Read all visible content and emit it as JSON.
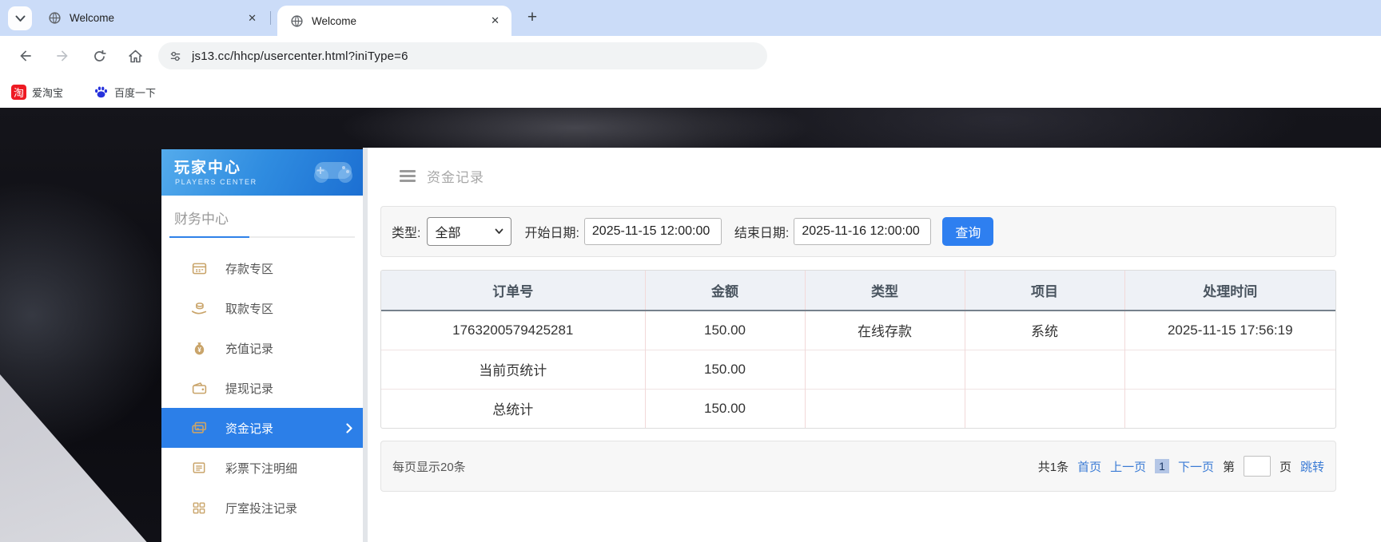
{
  "browser": {
    "tabs": [
      {
        "title": "Welcome",
        "icon": "globe-icon"
      },
      {
        "title": "Welcome",
        "icon": "globe-icon"
      }
    ],
    "url": "js13.cc/hhcp/usercenter.html?iniType=6",
    "bookmarks": [
      {
        "label": "爱淘宝",
        "icon": "taobao-icon",
        "icon_glyph": "淘"
      },
      {
        "label": "百度一下",
        "icon": "baidu-paw-icon"
      }
    ]
  },
  "sidebar": {
    "title": "玩家中心",
    "subtitle": "PLAYERS CENTER",
    "section": "财务中心",
    "items": [
      {
        "label": "存款专区",
        "icon": "deposit-machine-icon",
        "active": false
      },
      {
        "label": "取款专区",
        "icon": "withdraw-hand-icon",
        "active": false
      },
      {
        "label": "充值记录",
        "icon": "moneybag-icon",
        "active": false
      },
      {
        "label": "提现记录",
        "icon": "wallet-icon",
        "active": false
      },
      {
        "label": "资金记录",
        "icon": "cards-icon",
        "active": true
      },
      {
        "label": "彩票下注明细",
        "icon": "bet-list-icon",
        "active": false
      },
      {
        "label": "厅室投注记录",
        "icon": "grid-list-icon",
        "active": false
      }
    ]
  },
  "main": {
    "page_title": "资金记录",
    "filter": {
      "type_label": "类型:",
      "type_value": "全部",
      "start_label": "开始日期:",
      "start_value": "2025-11-15 12:00:00",
      "end_label": "结束日期:",
      "end_value": "2025-11-16 12:00:00",
      "search_label": "查询"
    },
    "table": {
      "headers": [
        "订单号",
        "金额",
        "类型",
        "项目",
        "处理时间"
      ],
      "rows": [
        [
          "1763200579425281",
          "150.00",
          "在线存款",
          "系统",
          "2025-11-15 17:56:19"
        ],
        [
          "当前页统计",
          "150.00",
          "",
          "",
          ""
        ],
        [
          "总统计",
          "150.00",
          "",
          "",
          ""
        ]
      ]
    },
    "pagination": {
      "per_page": "每页显示20条",
      "total": "共1条",
      "first": "首页",
      "prev": "上一页",
      "current": "1",
      "next": "下一页",
      "jump_pre": "第",
      "jump_post": "页",
      "jump": "跳转",
      "page_input_value": ""
    }
  },
  "colors": {
    "tabstrip_bg": "#cbdcf8",
    "accent_blue": "#2c7fe8",
    "button_blue": "#2e7ff0",
    "link_blue": "#3a7bd5",
    "gold_icon": "#c9a46a",
    "sidebar_gradient_start": "#54abec",
    "sidebar_gradient_end": "#1c6fd2",
    "table_header_bg": "#eef1f6",
    "table_divider_pink": "#f2d9d9",
    "taobao_red": "#ee1a23",
    "baidu_blue": "#2732dc"
  }
}
